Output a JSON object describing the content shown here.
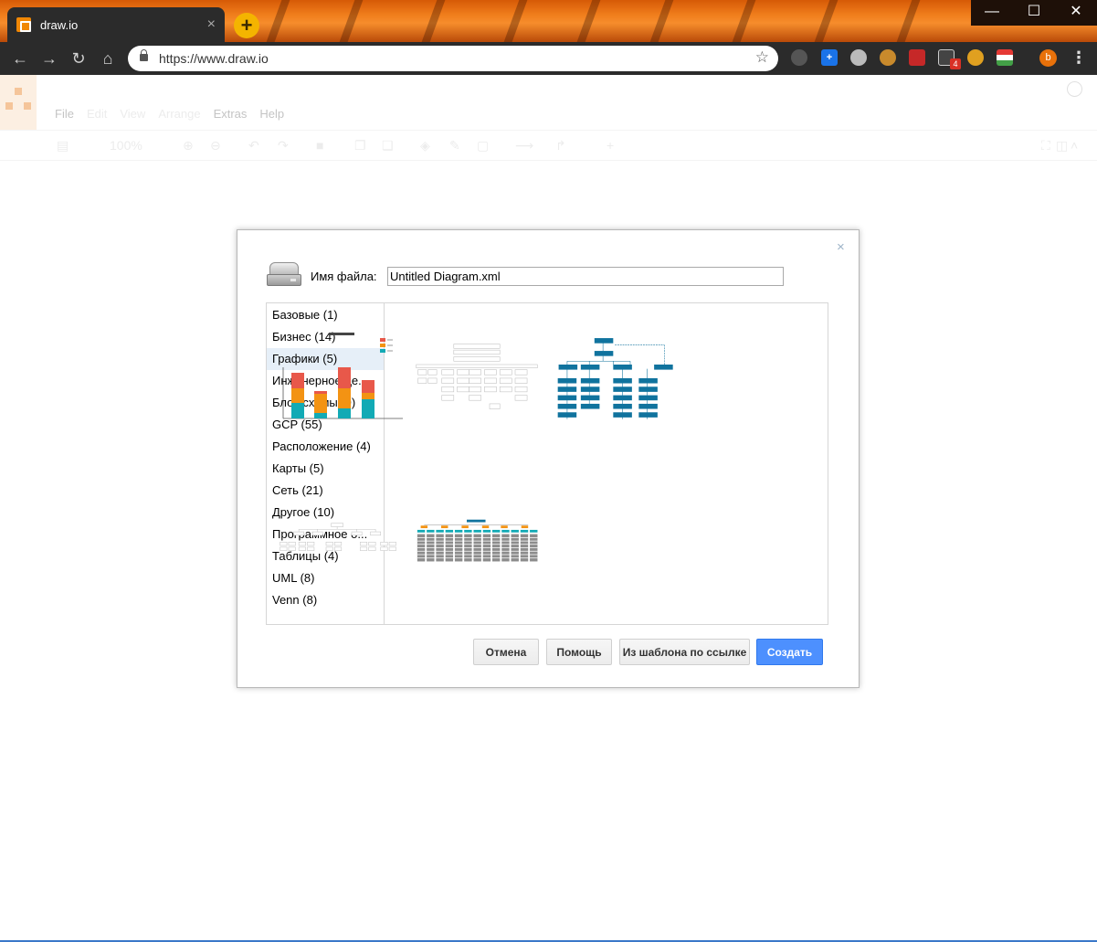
{
  "browser": {
    "tab_title": "draw.io",
    "tab_close": "×",
    "new_tab": "+",
    "url": "https://www.draw.io",
    "extension_badge": "4",
    "profile_initial": "b"
  },
  "app": {
    "menu": [
      "File",
      "Edit",
      "View",
      "Arrange",
      "Extras",
      "Help"
    ],
    "zoom": "100%"
  },
  "dialog": {
    "close": "×",
    "filename_label": "Имя файла:",
    "filename_value": "Untitled Diagram.xml",
    "categories": [
      "Базовые (1)",
      "Бизнес (14)",
      "Графики (5)",
      "Инженерное де...",
      "Блок-схемы (9)",
      "GCP (55)",
      "Расположение (4)",
      "Карты (5)",
      "Сеть (21)",
      "Другое (10)",
      "Программное о...",
      "Таблицы (4)",
      "UML (8)",
      "Venn (8)"
    ],
    "selected_category": "Графики (5)",
    "templates": [
      "bar-chart",
      "org-table",
      "org-chart-blue",
      "tree-table",
      "orange-grid"
    ],
    "buttons": {
      "cancel": "Отмена",
      "help": "Помощь",
      "from_url": "Из шаблона по ссылке",
      "create": "Создать"
    }
  },
  "colors": {
    "primary_button": "#4d90fe",
    "selected_category": "#e6eff8",
    "chart_red": "#e8584a",
    "chart_orange": "#f39313",
    "chart_teal": "#12aab5",
    "org_blue": "#10739e"
  }
}
